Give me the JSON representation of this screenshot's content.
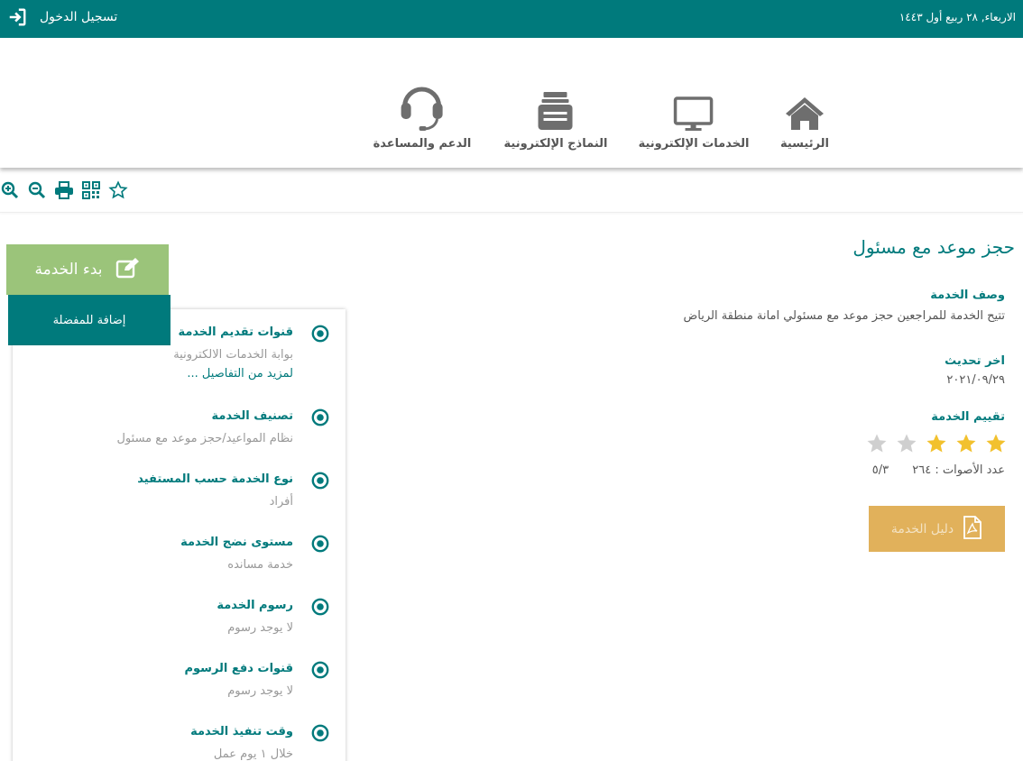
{
  "topbar": {
    "date": "الاربعاء, ٢٨ ربيع أول ١٤٤٣",
    "login_label": "تسجيل الدخول"
  },
  "nav": {
    "items": [
      {
        "label": "الرئيسية",
        "icon": "home-icon"
      },
      {
        "label": "الخدمات الإلكترونية",
        "icon": "monitor-icon"
      },
      {
        "label": "النماذج الإلكترونية",
        "icon": "forms-icon"
      },
      {
        "label": "الدعم والمساعدة",
        "icon": "headset-icon"
      }
    ]
  },
  "tools": [
    "zoom-in-icon",
    "zoom-out-icon",
    "print-icon",
    "qr-code-icon",
    "star-outline-icon"
  ],
  "service": {
    "title": "حجز موعد مع مسئول",
    "description_label": "وصف الخدمة",
    "description": "تتيح الخدمة للمراجعين حجز موعد مع مسئولي امانة منطقة الرياض",
    "updated_label": "اخر تحديث",
    "updated": "٢٠٢١/٠٩/٢٩",
    "rating_label": "تقييم الخدمة",
    "rating": 3,
    "rating_max": 5,
    "votes_label": "عدد الأصوات : ٢٦٤",
    "score": "٥/٣",
    "guide_label": "دليل الخدمة"
  },
  "buttons": {
    "start": "بدء الخدمة",
    "favorite": "إضافة للمفضلة"
  },
  "details": [
    {
      "label": "قنوات تقديم الخدمة",
      "value": "بوابة الخدمات الالكترونية",
      "link": "لمزيد من التفاصيل ..."
    },
    {
      "label": "تصنيف الخدمة",
      "value": "نظام المواعيد/حجز موعد مع مسئول"
    },
    {
      "label": "نوع الخدمة حسب المستفيد",
      "value": "أفراد"
    },
    {
      "label": "مستوى نضج الخدمة",
      "value": "خدمة مسانده"
    },
    {
      "label": "رسوم الخدمة",
      "value": "لا يوجد رسوم"
    },
    {
      "label": "قنوات دفع الرسوم",
      "value": "لا يوجد رسوم"
    },
    {
      "label": "وقت تنفيذ الخدمة",
      "value": "خلال ١ يوم عمل"
    }
  ],
  "colors": {
    "primary": "#007a7c",
    "start": "#9bc47a",
    "guide": "#e1b15b",
    "star_on": "#f2c12e",
    "star_off": "#cfcfcf"
  }
}
